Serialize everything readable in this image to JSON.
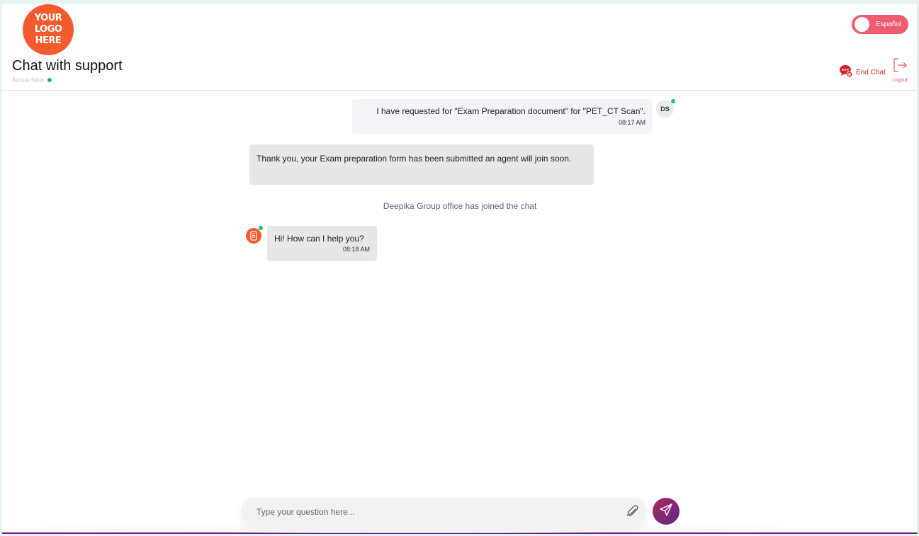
{
  "header": {
    "logo_text": "YOUR\nLOGO\nHERE",
    "title": "Chat with support",
    "status": "Active Now",
    "language_toggle": "Español",
    "end_chat": "End Chat",
    "logout": "Logout"
  },
  "messages": {
    "user": {
      "initials": "DS",
      "text": "I have requested for \"Exam Preparation document\" for \"PET_CT Scan\".",
      "time": "08:17 AM"
    },
    "system": {
      "text": "Thank you, your Exam preparation form has been submitted an agent will join soon."
    },
    "join_notice": "Deepika Group office has joined the chat",
    "agent": {
      "text": "Hi! How can I help you?",
      "time": "08:18 AM"
    }
  },
  "composer": {
    "placeholder": "Type your question here..."
  },
  "colors": {
    "brand_orange": "#f35a2e",
    "toggle_pink": "#ef5c72",
    "end_chat_red": "#d4202c",
    "online_green": "#22c55e",
    "status_teal": "#14b39e",
    "send_gradient": "#b3245e-#5a2a8a"
  },
  "icons": [
    "end-chat-icon",
    "logout-icon",
    "attach-icon",
    "send-icon",
    "agent-avatar-icon"
  ]
}
